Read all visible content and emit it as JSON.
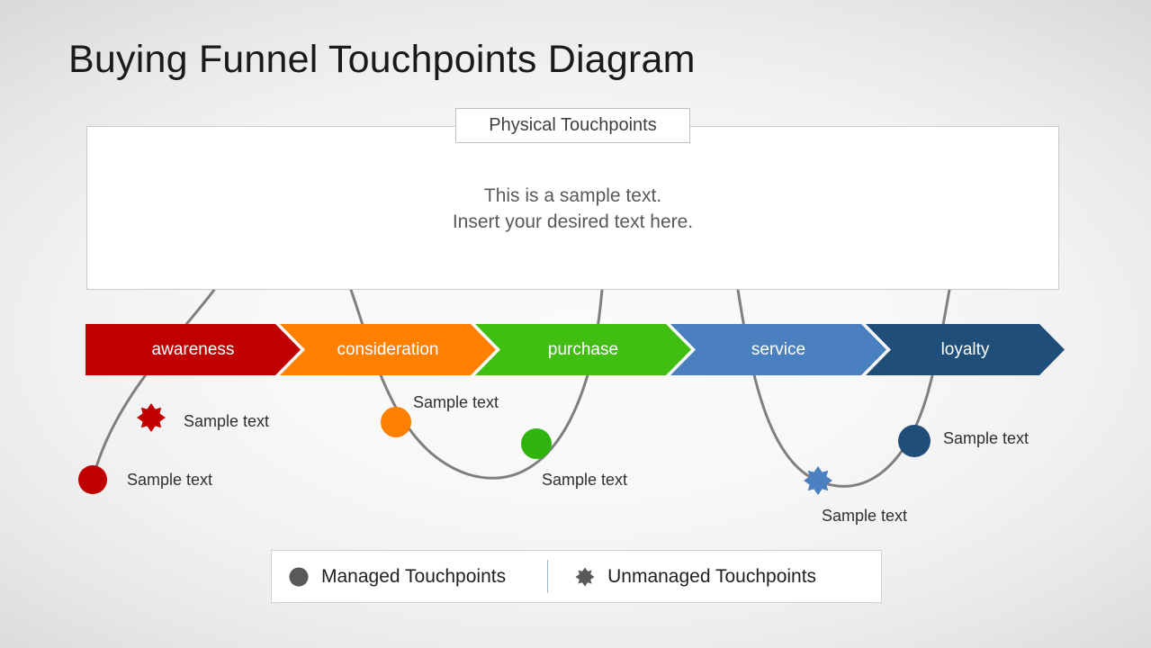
{
  "slide": {
    "title": "Buying Funnel Touchpoints Diagram",
    "background_color": "#f4f4f4"
  },
  "panel": {
    "label": "Physical Touchpoints",
    "line1": "This is a sample text.",
    "line2": "Insert your desired text here."
  },
  "funnel": {
    "stages": [
      {
        "label": "awareness",
        "color": "#c00000"
      },
      {
        "label": "consideration",
        "color": "#ff8000"
      },
      {
        "label": "purchase",
        "color": "#41be12"
      },
      {
        "label": "service",
        "color": "#4a80c0"
      },
      {
        "label": "loyalty",
        "color": "#1f4e79"
      }
    ]
  },
  "touchpoints": [
    {
      "id": "awareness-managed",
      "caption": "Sample text",
      "shape": "circle",
      "color": "#c00000",
      "stage": "awareness"
    },
    {
      "id": "awareness-unmanaged",
      "caption": "Sample text",
      "shape": "star",
      "color": "#c00000",
      "stage": "awareness"
    },
    {
      "id": "consideration-managed",
      "caption": "Sample text",
      "shape": "circle",
      "color": "#ff8000",
      "stage": "consideration"
    },
    {
      "id": "purchase-managed",
      "caption": "Sample text",
      "shape": "circle",
      "color": "#2fb40d",
      "stage": "purchase"
    },
    {
      "id": "service-unmanaged",
      "caption": "Sample text",
      "shape": "star",
      "color": "#4a80c0",
      "stage": "service"
    },
    {
      "id": "loyalty-managed",
      "caption": "Sample text",
      "shape": "circle",
      "color": "#1f4e79",
      "stage": "loyalty"
    }
  ],
  "legend": {
    "managed_label": "Managed Touchpoints",
    "unmanaged_label": "Unmanaged Touchpoints",
    "swatch_color": "#595959"
  }
}
